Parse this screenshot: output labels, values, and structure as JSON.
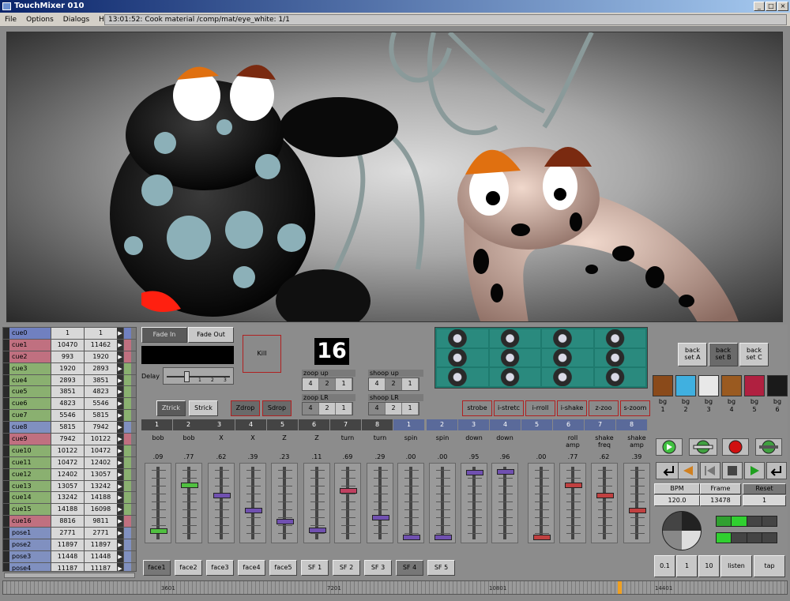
{
  "window": {
    "title": "TouchMixer 010"
  },
  "menu": {
    "items": [
      "File",
      "Options",
      "Dialogs",
      "Help"
    ],
    "status": "13:01:52:  Cook material /comp/mat/eye_white: 1/1"
  },
  "cues": [
    {
      "name": "cue0",
      "a": "1",
      "b": "1",
      "color": "#7080c0"
    },
    {
      "name": "cue1",
      "a": "10470",
      "b": "11462",
      "color": "#c07080"
    },
    {
      "name": "cue2",
      "a": "993",
      "b": "1920",
      "color": "#c07080"
    },
    {
      "name": "cue3",
      "a": "1920",
      "b": "2893",
      "color": "#8ab070"
    },
    {
      "name": "cue4",
      "a": "2893",
      "b": "3851",
      "color": "#8ab070"
    },
    {
      "name": "cue5",
      "a": "3851",
      "b": "4823",
      "color": "#8ab070"
    },
    {
      "name": "cue6",
      "a": "4823",
      "b": "5546",
      "color": "#8ab070"
    },
    {
      "name": "cue7",
      "a": "5546",
      "b": "5815",
      "color": "#8ab070"
    },
    {
      "name": "cue8",
      "a": "5815",
      "b": "7942",
      "color": "#8090c0"
    },
    {
      "name": "cue9",
      "a": "7942",
      "b": "10122",
      "color": "#c07080"
    },
    {
      "name": "cue10",
      "a": "10122",
      "b": "10472",
      "color": "#8ab070"
    },
    {
      "name": "cue11",
      "a": "10472",
      "b": "12402",
      "color": "#8ab070"
    },
    {
      "name": "cue12",
      "a": "12402",
      "b": "13057",
      "color": "#8ab070"
    },
    {
      "name": "cue13",
      "a": "13057",
      "b": "13242",
      "color": "#8ab070"
    },
    {
      "name": "cue14",
      "a": "13242",
      "b": "14188",
      "color": "#8ab070"
    },
    {
      "name": "cue15",
      "a": "14188",
      "b": "16098",
      "color": "#8ab070"
    },
    {
      "name": "cue16",
      "a": "8816",
      "b": "9811",
      "color": "#c07080"
    },
    {
      "name": "pose1",
      "a": "2771",
      "b": "2771",
      "color": "#8090c0"
    },
    {
      "name": "pose2",
      "a": "11897",
      "b": "11897",
      "color": "#8090c0"
    },
    {
      "name": "pose3",
      "a": "11448",
      "b": "11448",
      "color": "#8090c0"
    },
    {
      "name": "pose4",
      "a": "11187",
      "b": "11187",
      "color": "#8090c0"
    }
  ],
  "fade": {
    "fade_in": "Fade In",
    "fade_out": "Fade Out",
    "delay": "Delay",
    "kill": "Kill",
    "counter": "16"
  },
  "delay_ticks": [
    "1",
    "2",
    "3"
  ],
  "tricks": {
    "ztrick": "Ztrick",
    "strick": "Strick",
    "zdrop": "Zdrop",
    "sdrop": "Sdrop"
  },
  "groups": {
    "zoop_up": "zoop up",
    "shoop_up": "shoop up",
    "zoop_lr": "zoop LR",
    "shoop_lr": "shoop LR",
    "seg_values": [
      "4",
      "2",
      "1"
    ]
  },
  "effects": [
    "strobe",
    "i-stretc",
    "i-rroll",
    "i-shake",
    "z-zoo",
    "s-zoom"
  ],
  "back_sets": [
    "back\nset A",
    "back\nset B",
    "back\nset C"
  ],
  "backgrounds": [
    {
      "label": "bg\n1",
      "color": "#8a4a1a"
    },
    {
      "label": "bg\n2",
      "color": "#40b0e0"
    },
    {
      "label": "bg\n3",
      "color": "#e8e8e8"
    },
    {
      "label": "bg\n4",
      "color": "#9a5a20"
    },
    {
      "label": "bg\n5",
      "color": "#b02040"
    },
    {
      "label": "bg\n6",
      "color": "#1a1a1a"
    }
  ],
  "fader_heads": [
    "1",
    "2",
    "3",
    "4",
    "5",
    "6",
    "7",
    "8",
    "1",
    "2",
    "3",
    "4",
    "5",
    "6",
    "7",
    "8"
  ],
  "faders": [
    {
      "name": "bob",
      "value": ".09",
      "level": 0.09,
      "color": "#50c040"
    },
    {
      "name": "bob",
      "value": ".77",
      "level": 0.77,
      "color": "#50c040"
    },
    {
      "name": "X",
      "value": ".62",
      "level": 0.62,
      "color": "#7050b0"
    },
    {
      "name": "X",
      "value": ".39",
      "level": 0.39,
      "color": "#7050b0"
    },
    {
      "name": "Z",
      "value": ".23",
      "level": 0.23,
      "color": "#7050b0"
    },
    {
      "name": "Z",
      "value": ".11",
      "level": 0.11,
      "color": "#7050b0"
    },
    {
      "name": "turn",
      "value": ".69",
      "level": 0.69,
      "color": "#c04060"
    },
    {
      "name": "turn",
      "value": ".29",
      "level": 0.29,
      "color": "#7050b0"
    },
    {
      "name": "spin",
      "value": ".00",
      "level": 0.0,
      "color": "#7050b0"
    },
    {
      "name": "spin",
      "value": ".00",
      "level": 0.0,
      "color": "#7050b0"
    },
    {
      "name": "down",
      "value": ".95",
      "level": 0.95,
      "color": "#7050b0"
    },
    {
      "name": "down",
      "value": ".96",
      "level": 0.96,
      "color": "#7050b0"
    },
    {
      "name": "",
      "value": ".00",
      "level": 0.0,
      "color": "#c04040"
    },
    {
      "name": "roll\namp",
      "value": ".77",
      "level": 0.77,
      "color": "#c04040"
    },
    {
      "name": "shake\nfreq",
      "value": ".62",
      "level": 0.62,
      "color": "#c04040"
    },
    {
      "name": "shake\namp",
      "value": ".39",
      "level": 0.39,
      "color": "#c04040"
    }
  ],
  "faces": [
    {
      "label": "face1",
      "active": true
    },
    {
      "label": "face2",
      "active": false
    },
    {
      "label": "face3",
      "active": false
    },
    {
      "label": "face4",
      "active": false
    },
    {
      "label": "face5",
      "active": false
    },
    {
      "label": "SF 1",
      "active": false
    },
    {
      "label": "SF 2",
      "active": false
    },
    {
      "label": "SF 3",
      "active": false
    },
    {
      "label": "SF 4",
      "active": true
    },
    {
      "label": "SF 5",
      "active": false
    }
  ],
  "tempo": {
    "bpm_label": "BPM",
    "frame_label": "Frame",
    "reset_label": "Reset",
    "bpm": "120.0",
    "frame": "13478",
    "reset": "1"
  },
  "bottom_buttons": [
    "0.1",
    "1",
    "10",
    "listen",
    "tap"
  ],
  "timeline": {
    "labels": [
      "3601",
      "7201",
      "10801",
      "14401"
    ]
  }
}
